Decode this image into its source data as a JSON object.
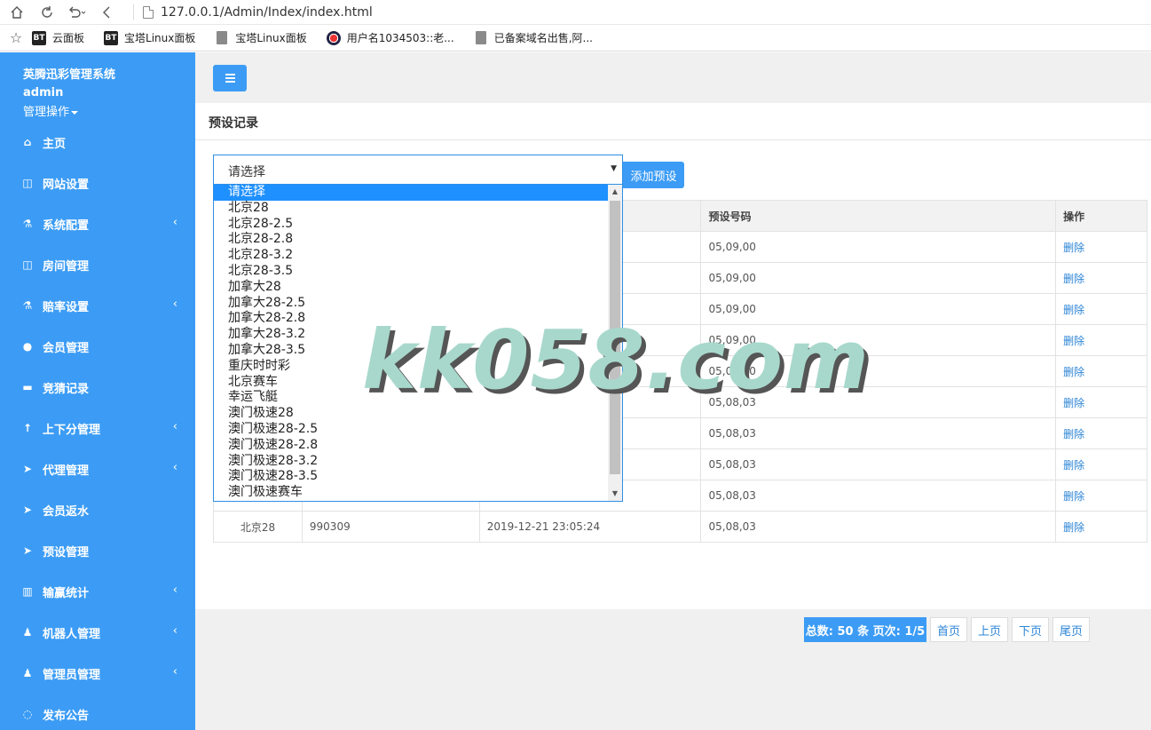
{
  "browser": {
    "url": "127.0.0.1/Admin/Index/index.html",
    "nav_icons": [
      "home-icon",
      "refresh-icon",
      "undo-icon",
      "back-icon"
    ],
    "bookmarks": [
      {
        "icon": "bt",
        "label": "云面板"
      },
      {
        "icon": "bt",
        "label": "宝塔Linux面板"
      },
      {
        "icon": "doc",
        "label": "宝塔Linux面板"
      },
      {
        "icon": "weibo",
        "label": "用户名1034503::老..."
      },
      {
        "icon": "doc",
        "label": "已备案域名出售,阿..."
      }
    ]
  },
  "sidebar": {
    "brand": "英腾迅彩管理系统",
    "user": "admin",
    "ops": "管理操作",
    "items": [
      {
        "label": "主页",
        "icon": "home-icon",
        "glyph": "⌂",
        "arrow": false
      },
      {
        "label": "网站设置",
        "icon": "columns-icon",
        "glyph": "◫",
        "arrow": false
      },
      {
        "label": "系统配置",
        "icon": "flask-icon",
        "glyph": "⚗",
        "arrow": true
      },
      {
        "label": "房间管理",
        "icon": "columns-icon",
        "glyph": "◫",
        "arrow": false
      },
      {
        "label": "赔率设置",
        "icon": "flask-icon",
        "glyph": "⚗",
        "arrow": true
      },
      {
        "label": "会员管理",
        "icon": "user-icon",
        "glyph": "●",
        "arrow": false
      },
      {
        "label": "竞猜记录",
        "icon": "car-icon",
        "glyph": "▬",
        "arrow": false
      },
      {
        "label": "上下分管理",
        "icon": "arrow-up-icon",
        "glyph": "↑",
        "arrow": true
      },
      {
        "label": "代理管理",
        "icon": "send-icon",
        "glyph": "➤",
        "arrow": true
      },
      {
        "label": "会员返水",
        "icon": "send-icon",
        "glyph": "➤",
        "arrow": false
      },
      {
        "label": "预设管理",
        "icon": "send-icon",
        "glyph": "➤",
        "arrow": false
      },
      {
        "label": "输赢统计",
        "icon": "bar-chart-icon",
        "glyph": "▥",
        "arrow": true
      },
      {
        "label": "机器人管理",
        "icon": "male-icon",
        "glyph": "♟",
        "arrow": true
      },
      {
        "label": "管理员管理",
        "icon": "male-icon",
        "glyph": "♟",
        "arrow": true
      },
      {
        "label": "发布公告",
        "icon": "comment-icon",
        "glyph": "◌",
        "arrow": false
      }
    ]
  },
  "main": {
    "panel_title": "预设记录",
    "select": {
      "value": "请选择"
    },
    "add_button": "添加预设",
    "dropdown_options": [
      "请选择",
      "北京28",
      "北京28-2.5",
      "北京28-2.8",
      "北京28-3.2",
      "北京28-3.5",
      "加拿大28",
      "加拿大28-2.5",
      "加拿大28-2.8",
      "加拿大28-3.2",
      "加拿大28-3.5",
      "重庆时时彩",
      "北京赛车",
      "幸运飞艇",
      "澳门极速28",
      "澳门极速28-2.5",
      "澳门极速28-2.8",
      "澳门极速28-3.2",
      "澳门极速28-3.5",
      "澳门极速赛车"
    ],
    "table": {
      "headers": [
        "",
        "",
        "",
        "预设号码",
        "操作"
      ],
      "rows": [
        [
          "",
          "",
          "",
          "05,09,00",
          "删除"
        ],
        [
          "",
          "",
          "",
          "05,09,00",
          "删除"
        ],
        [
          "",
          "",
          "",
          "05,09,00",
          "删除"
        ],
        [
          "",
          "",
          "",
          "05,09,00",
          "删除"
        ],
        [
          "",
          "",
          "",
          "05,09,00",
          "删除"
        ],
        [
          "",
          "",
          "",
          "05,08,03",
          "删除"
        ],
        [
          "",
          "",
          "",
          "05,08,03",
          "删除"
        ],
        [
          "",
          "",
          "",
          "05,08,03",
          "删除"
        ],
        [
          "",
          "",
          "",
          "05,08,03",
          "删除"
        ],
        [
          "北京28",
          "990309",
          "2019-12-21 23:05:24",
          "05,08,03",
          "删除"
        ]
      ]
    },
    "pagination": {
      "summary": "总数: 50 条 页次: 1/5",
      "buttons": [
        "首页",
        "上页",
        "下页",
        "尾页"
      ]
    }
  },
  "watermark": "kk058.com"
}
